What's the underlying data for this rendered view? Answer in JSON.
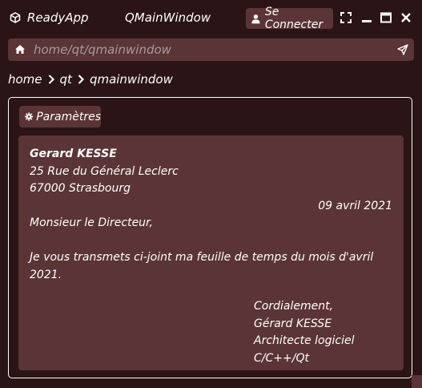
{
  "titlebar": {
    "app_name": "ReadyApp",
    "window_title": "QMainWindow",
    "connect_label": "Se Connecter",
    "icons": [
      "cube-icon",
      "user-icon",
      "fullscreen-icon",
      "minimize-icon",
      "maximize-icon",
      "close-icon"
    ]
  },
  "address": {
    "value": "home/qt/qmainwindow",
    "icons": [
      "home-icon",
      "send-icon"
    ]
  },
  "breadcrumb": {
    "items": [
      "home",
      "qt",
      "qmainwindow"
    ]
  },
  "settings": {
    "label": "Paramètres",
    "icon": "gear-icon"
  },
  "letter": {
    "sender_name": "Gerard KESSE",
    "sender_street": "25 Rue du Général Leclerc",
    "sender_city": "67000 Strasbourg",
    "date": "09 avril 2021",
    "salutation": "Monsieur le Directeur,",
    "body": "Je vous transmets ci-joint ma feuille de temps du mois d'avril 2021.",
    "closing": "Cordialement,",
    "signature_name": "Gérard KESSE",
    "signature_title": "Architecte logiciel C/C++/Qt"
  },
  "colors": {
    "background": "#2a1416",
    "panel": "#5a3436",
    "text": "#ffffff",
    "placeholder_text": "#a99a9b"
  }
}
